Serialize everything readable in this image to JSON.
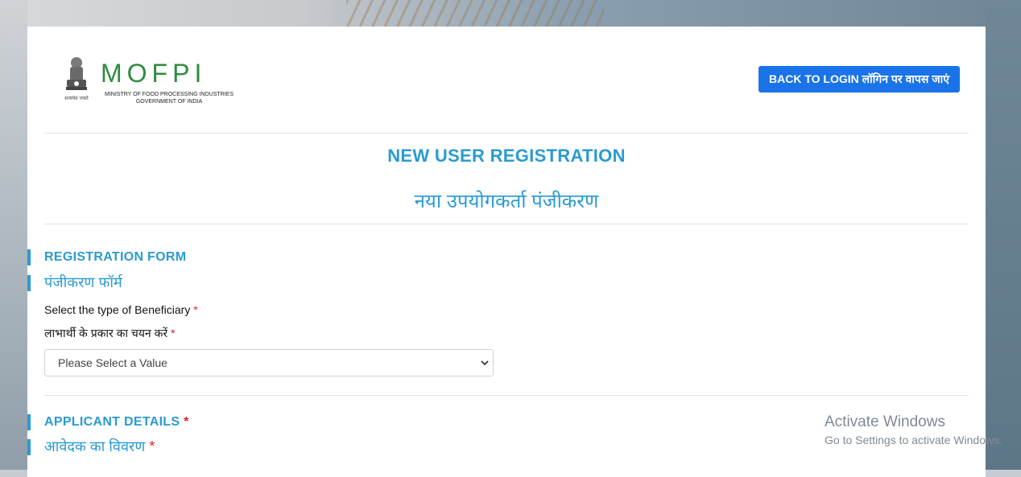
{
  "header": {
    "logo_text": "MOFPI",
    "logo_subtitle_line1": "MINISTRY OF FOOD PROCESSING INDUSTRIES",
    "logo_subtitle_line2": "GOVERNMENT OF INDIA",
    "emblem_caption": "सत्यमेव जयते",
    "back_button_label": "BACK TO LOGIN लॉगिन पर वापस जाएं"
  },
  "page": {
    "title_en": "NEW USER REGISTRATION",
    "title_hi": "नया उपयोगकर्ता पंजीकरण"
  },
  "registration_form": {
    "heading_en": "REGISTRATION FORM",
    "heading_hi": "पंजीकरण फॉर्म",
    "beneficiary_label_en": "Select the type of Beneficiary",
    "beneficiary_label_hi": "लाभार्थी के प्रकार का चयन करें",
    "required_mark": "*",
    "select_value": "Please Select a Value"
  },
  "applicant_details": {
    "heading_en": "APPLICANT DETAILS",
    "heading_hi": "आवेदक का विवरण",
    "required_mark": "*"
  },
  "watermark": {
    "line1": "Activate Windows",
    "line2": "Go to Settings to activate Windows."
  },
  "colors": {
    "accent": "#2a9bd1",
    "button": "#1a73e8",
    "required": "#e02020",
    "logo_green": "#2e8b3e",
    "logo_orange": "#e07b1a"
  }
}
